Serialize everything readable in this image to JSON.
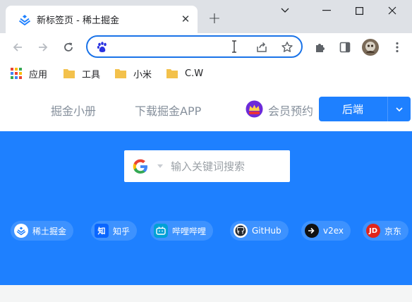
{
  "tab": {
    "title": "新标签页 - 稀土掘金",
    "close_label": "✕"
  },
  "newtab_label": "+",
  "window": {
    "minimize": "minimize-icon",
    "maximize": "maximize-icon",
    "close": "close-icon"
  },
  "omnibox": {
    "value": "",
    "placeholder": ""
  },
  "bookmarks": [
    {
      "label": "应用",
      "icon": "apps-grid-icon"
    },
    {
      "label": "工具",
      "icon": "folder-icon"
    },
    {
      "label": "小米",
      "icon": "folder-icon"
    },
    {
      "label": "C.W",
      "icon": "folder-icon"
    }
  ],
  "nav": {
    "links": [
      "掘金小册",
      "下载掘金APP",
      "会员预约"
    ],
    "split_button": "后端"
  },
  "search": {
    "placeholder": "输入关键词搜索",
    "engine": "google-icon"
  },
  "quick_links": [
    {
      "label": "稀土掘金",
      "icon": "juejin-icon",
      "color": "#1e80ff"
    },
    {
      "label": "知乎",
      "icon": "zhihu-icon",
      "color": "#0a66ff"
    },
    {
      "label": "哔哩哔哩",
      "icon": "bilibili-icon",
      "color": "#00a1d6"
    },
    {
      "label": "GitHub",
      "icon": "github-icon",
      "color": "#24292f"
    },
    {
      "label": "v2ex",
      "icon": "v2ex-icon",
      "color": "#111111"
    },
    {
      "label": "京东",
      "icon": "jd-icon",
      "color": "#e1251b"
    }
  ],
  "colors": {
    "accent": "#1e80ff",
    "omnibox_focus": "#1a73e8",
    "tabstrip": "#dee1e6"
  }
}
